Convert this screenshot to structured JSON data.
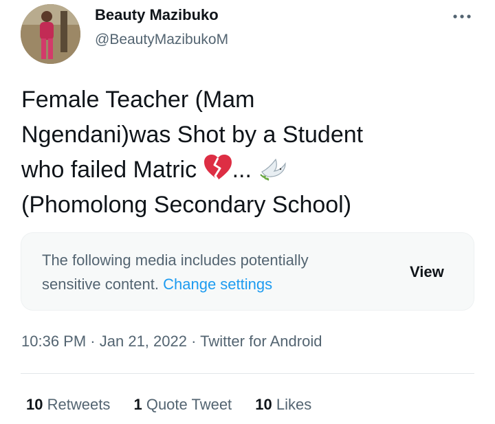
{
  "author": {
    "name": "Beauty Mazibuko",
    "handle": "@BeautyMazibukoM"
  },
  "tweet": {
    "line1": "Female Teacher (Mam",
    "line2": "Ngendani)was Shot by a Student",
    "line3_start": "who failed Matric",
    "line3_ellipsis": "...",
    "line4": "(Phomolong Secondary School)"
  },
  "sensitive": {
    "line1": "The following media includes potentially",
    "line2": "sensitive content.",
    "link": "Change settings",
    "button": "View"
  },
  "meta": {
    "time": "10:36 PM",
    "date": "Jan 21, 2022",
    "source": "Twitter for Android",
    "separator": "·"
  },
  "stats": {
    "retweets_count": "10",
    "retweets_label": "Retweets",
    "quotes_count": "1",
    "quotes_label": "Quote Tweet",
    "likes_count": "10",
    "likes_label": "Likes"
  },
  "icons": {
    "more": "more-options-icon",
    "heart": "broken-heart-icon",
    "dove": "dove-icon"
  },
  "colors": {
    "link": "#1d9bf0",
    "secondary_text": "#536471",
    "primary_text": "#0f1419"
  }
}
